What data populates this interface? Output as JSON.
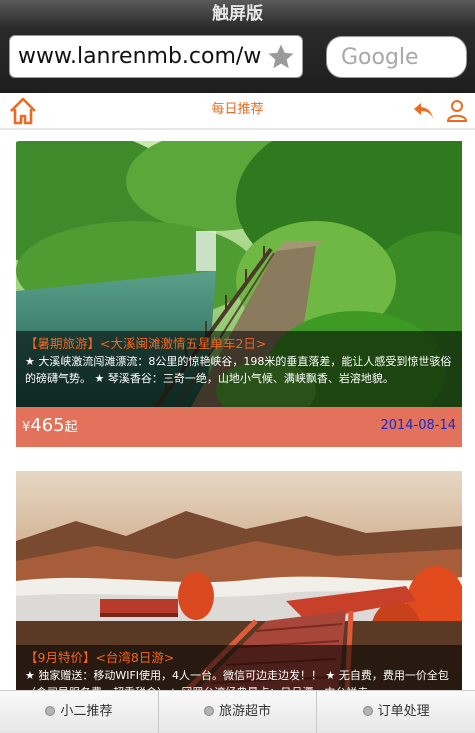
{
  "browser": {
    "title": "触屏版",
    "url": "www.lanrenmb.com/w",
    "search_placeholder": "Google"
  },
  "header": {
    "title": "每日推荐"
  },
  "cards": [
    {
      "title": "【暑期旅游】<大溪闽滩激情五星单车2日>",
      "description": "★ 大溪峡激流闯滩漂流：8公里的惊艳峡谷，198米的垂直落差，能让人感受到惊世骇俗的磅礴气势。 ★ 琴溪香谷：三奇一绝，山地小气候、满峡飘香、岩溶地貌。",
      "currency": "¥",
      "price": "465",
      "price_suffix": "起",
      "date": "2014-08-14"
    },
    {
      "title": "【9月特价】<台湾8日游>",
      "description": "★ 独家赠送：移动WIFI使用，4人一台。微信可边走边发！！ ★ 无自费，费用一价全包（含司导服务费、超重税金）★ 冈罗台湾经典景点：日月潭、中台禅寺"
    }
  ],
  "bottom_nav": [
    {
      "label": "小二推荐"
    },
    {
      "label": "旅游超市"
    },
    {
      "label": "订单处理"
    }
  ],
  "colors": {
    "accent": "#ef6a1f",
    "price_bar": "#e2725b",
    "date": "#1a2bc8"
  }
}
